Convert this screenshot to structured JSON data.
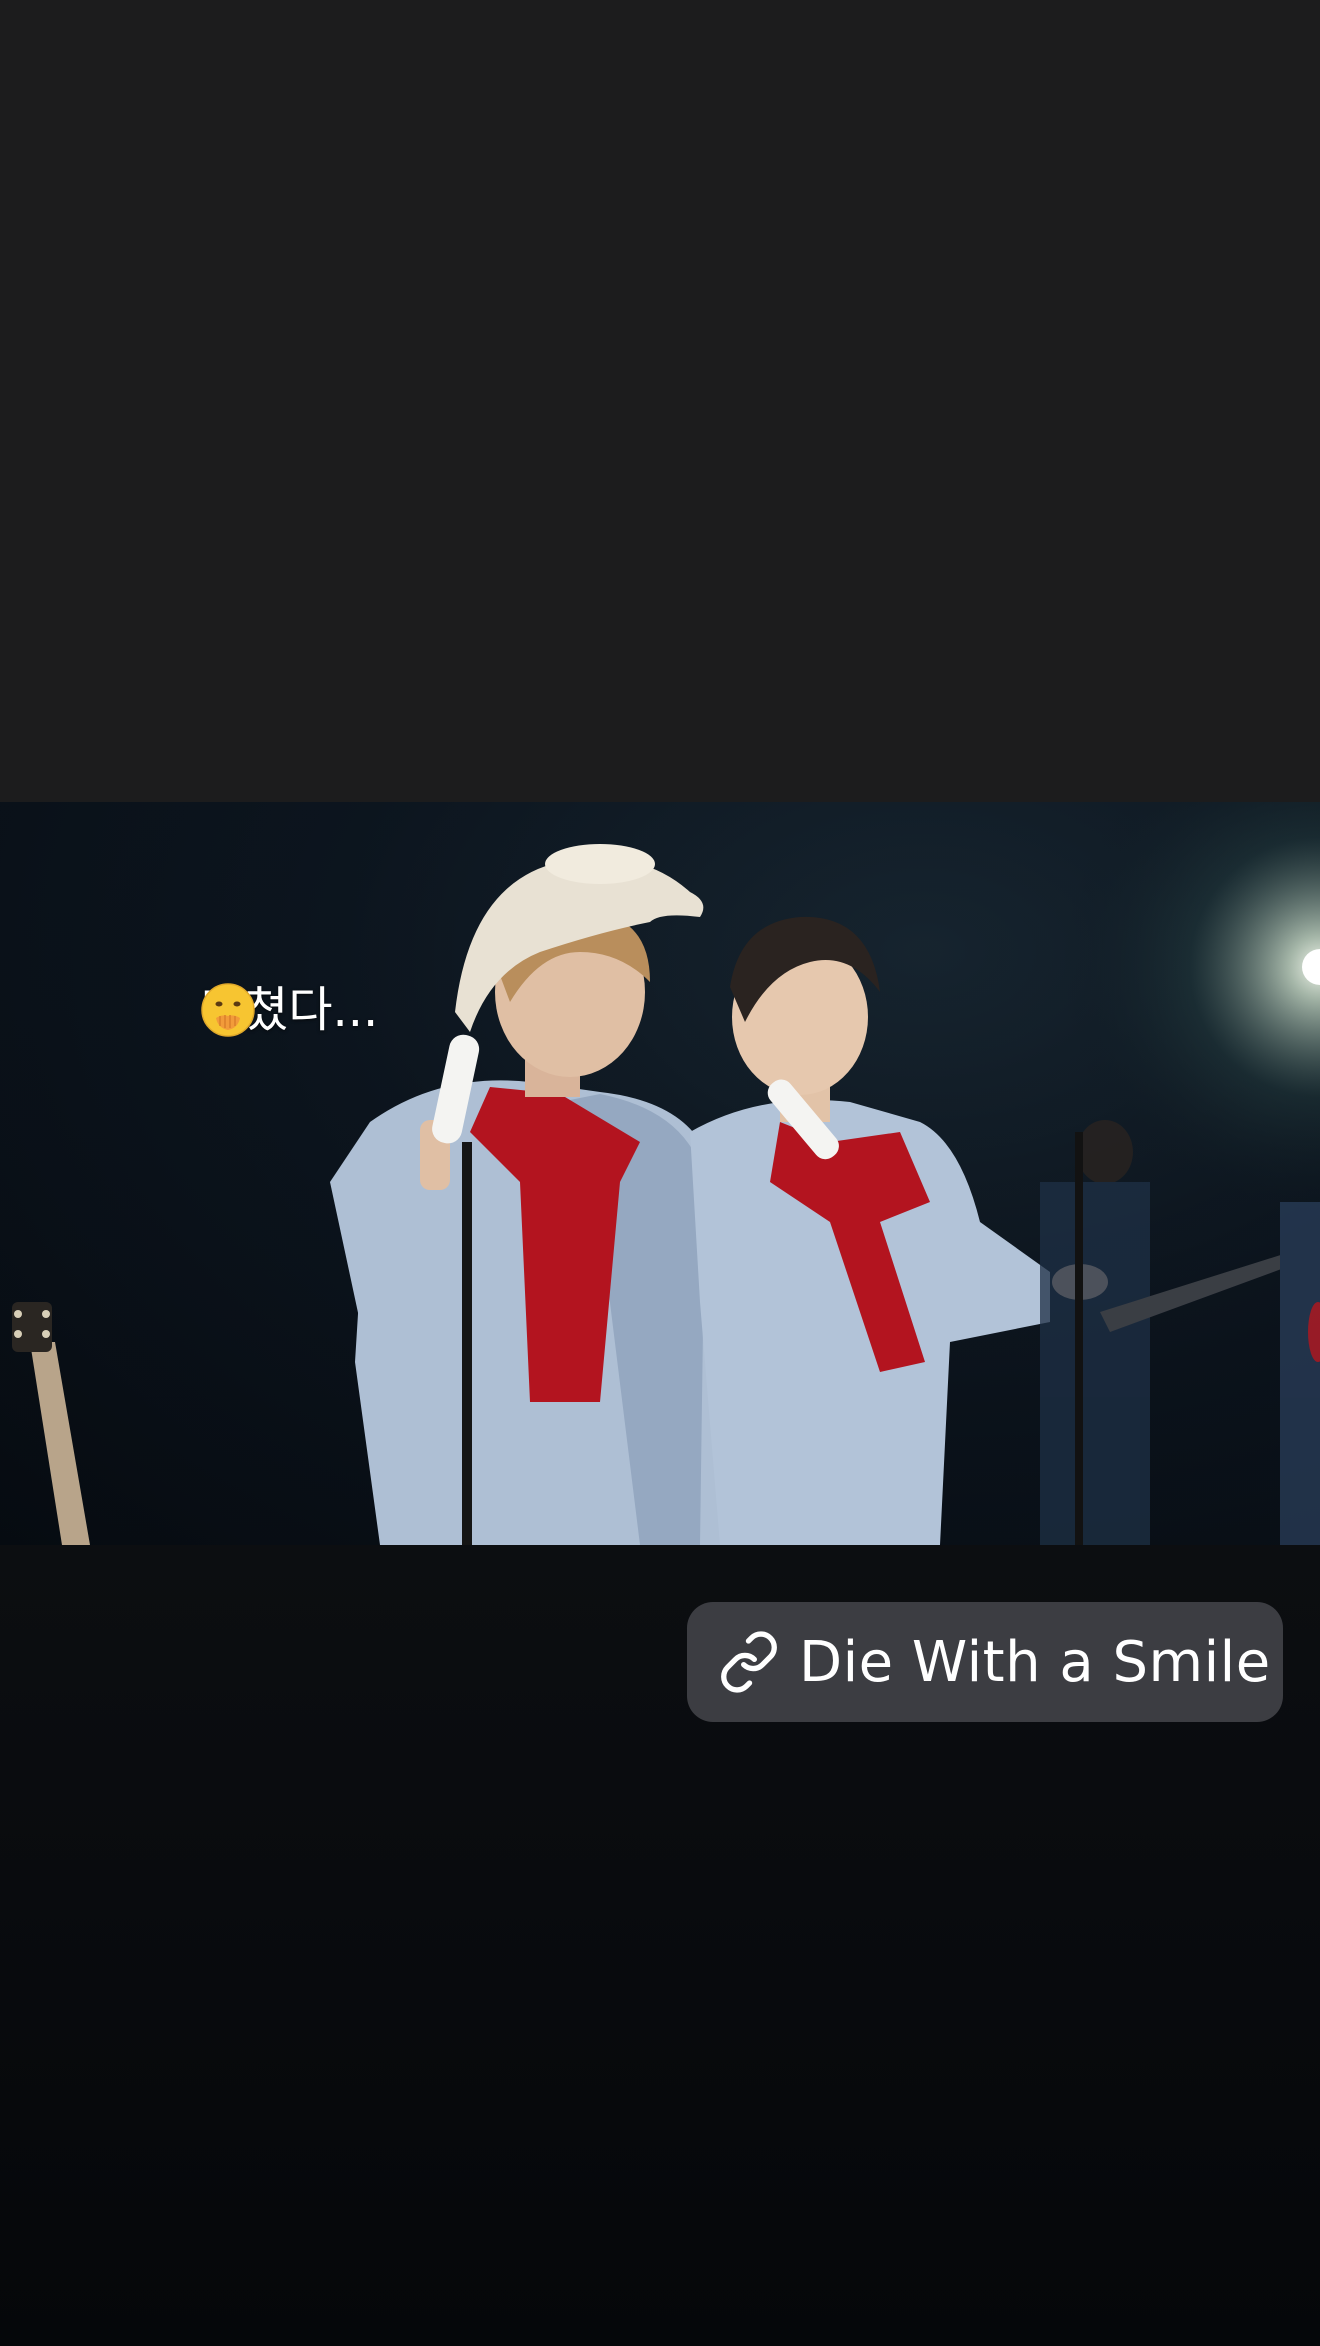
{
  "story": {
    "caption_text": "미쳤다...",
    "caption_emoji": "face-with-hand-over-mouth-emoji",
    "link_sticker": {
      "label": "Die With a Smile",
      "icon": "link-icon"
    }
  },
  "colors": {
    "background_top": "#1c1c1d",
    "background_bottom": "#05070a",
    "sticker_bg": "#3c3d42",
    "text": "#ffffff",
    "shirt_red": "#b3141f",
    "suit_blue": "#aebfd4",
    "hat_cream": "#e8e1d3"
  }
}
